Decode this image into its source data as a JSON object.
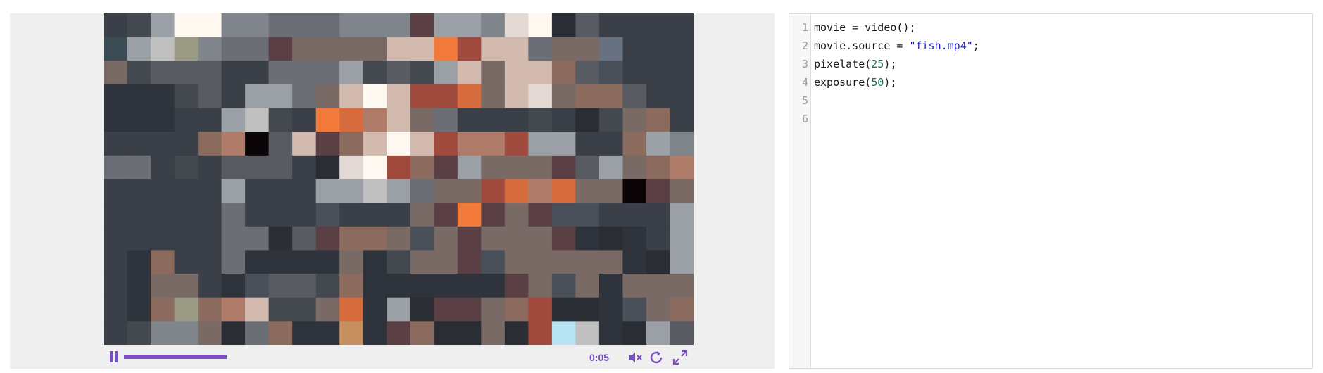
{
  "player": {
    "elapsed": "0:05",
    "progress_fraction": 0.28,
    "accent_color": "#7b4fbf",
    "icons": [
      "pause-icon",
      "mute-icon",
      "replay-icon",
      "fullscreen-icon"
    ]
  },
  "editor": {
    "lines": [
      {
        "number": "1",
        "parts": [
          {
            "text": "movie = video();",
            "kind": "plain"
          }
        ]
      },
      {
        "number": "2",
        "parts": [
          {
            "text": "movie.source = ",
            "kind": "plain"
          },
          {
            "text": "\"fish.mp4\"",
            "kind": "string"
          },
          {
            "text": ";",
            "kind": "plain"
          }
        ]
      },
      {
        "number": "3",
        "parts": [
          {
            "text": "pixelate(",
            "kind": "plain"
          },
          {
            "text": "25",
            "kind": "number"
          },
          {
            "text": ");",
            "kind": "plain"
          }
        ]
      },
      {
        "number": "4",
        "parts": [
          {
            "text": "exposure(",
            "kind": "plain"
          },
          {
            "text": "50",
            "kind": "number"
          },
          {
            "text": ");",
            "kind": "plain"
          }
        ]
      },
      {
        "number": "5",
        "parts": []
      },
      {
        "number": "6",
        "parts": []
      }
    ],
    "colors": {
      "string": "#1f1fcf",
      "number": "#13734f",
      "line_number": "#999999"
    }
  },
  "video_frame": {
    "grid": {
      "columns": 25,
      "rows": 14
    },
    "palette": {
      "a": "#3a3f48",
      "b": "#2f343c",
      "c": "#444950",
      "d": "#585b62",
      "e": "#6b6e74",
      "f": "#80848b",
      "g": "#9aa0a6",
      "h": "#c0c0c0",
      "i": "#e3d9d4",
      "j": "#fff8f0",
      "k": "#d2b9ae",
      "l": "#b07c6a",
      "m": "#f27a3a",
      "n": "#d66b3e",
      "o": "#a04a3e",
      "p": "#5a3f45",
      "q": "#7a6a66",
      "r": "#2a2d33",
      "s": "#0c0508",
      "t": "#c58f5f",
      "u": "#b8e3f2",
      "v": "#68717f",
      "w": "#9c9c86",
      "x": "#8a6b5d",
      "y": "#4a505a",
      "z": "#3c4c55"
    },
    "rows": [
      "acgjjffeeefffpggfijrdaaaa",
      "zghwfeepqqqqkkmokkeqqvaaa",
      "qcdddaaeeegcdcgkqkkxdyaaa",
      "bbbcdaggeqkjkoonqkiqxxdaa",
      "bbbaaghcamnlkqeaaacarcqxa",
      "aaaaxlsdkpxkjkolloggaaxgf",
      "eeacadddarijoxpgqqqpdgqxl",
      "aaaaagaaagghgeqqonlnqqspq",
      "aaaaaeaaayaaaqpmpqpyyaaag",
      "aaaaaeerdpxxqyqpqqqpbrbag",
      "abxaaebbbbqbcqqpyqqqqqbrg",
      "abqqabyddcxbbbbbbpqyqbqqq",
      "abxwxlkccqnbgrppqxorrbyqx",
      "acffqrexbbtbpxrrqrouhbrgd"
    ]
  }
}
